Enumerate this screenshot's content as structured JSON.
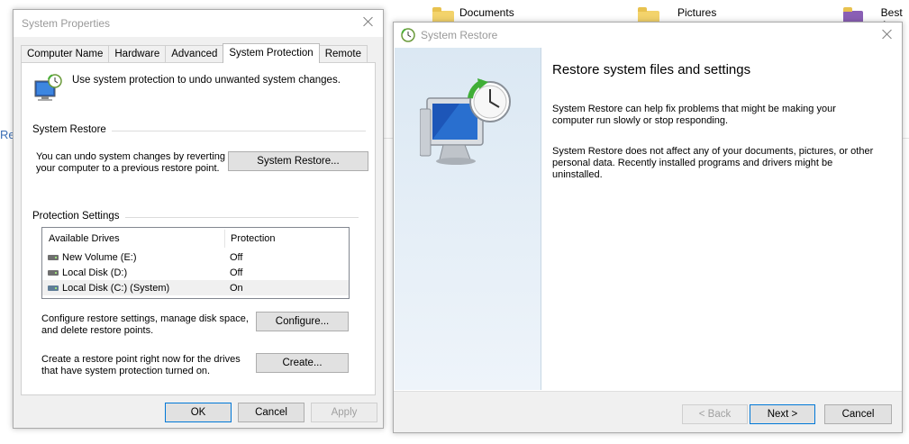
{
  "background": {
    "folders": [
      {
        "label": "Documents"
      },
      {
        "label": "Pictures"
      },
      {
        "label": "Best A"
      }
    ],
    "stub_text": "Re"
  },
  "system_properties": {
    "title": "System Properties",
    "tabs": [
      {
        "label": "Computer Name",
        "active": false
      },
      {
        "label": "Hardware",
        "active": false
      },
      {
        "label": "Advanced",
        "active": false
      },
      {
        "label": "System Protection",
        "active": true
      },
      {
        "label": "Remote",
        "active": false
      }
    ],
    "intro": "Use system protection to undo unwanted system changes.",
    "system_restore_group": {
      "title": "System Restore",
      "description": "You can undo system changes by reverting your computer to a previous restore point.",
      "button": "System Restore..."
    },
    "protection_group": {
      "title": "Protection Settings",
      "columns": [
        "Available Drives",
        "Protection"
      ],
      "drives": [
        {
          "name": "New Volume (E:)",
          "protection": "Off",
          "system": false,
          "selected": false
        },
        {
          "name": "Local Disk (D:)",
          "protection": "Off",
          "system": false,
          "selected": false
        },
        {
          "name": "Local Disk (C:) (System)",
          "protection": "On",
          "system": true,
          "selected": true
        }
      ],
      "configure_text": "Configure restore settings, manage disk space, and delete restore points.",
      "configure_button": "Configure...",
      "create_text": "Create a restore point right now for the drives that have system protection turned on.",
      "create_button": "Create..."
    },
    "buttons": {
      "ok": "OK",
      "cancel": "Cancel",
      "apply": "Apply"
    }
  },
  "system_restore": {
    "title": "System Restore",
    "heading": "Restore system files and settings",
    "paragraph1": "System Restore can help fix problems that might be making your computer run slowly or stop responding.",
    "paragraph2": "System Restore does not affect any of your documents, pictures, or other personal data. Recently installed programs and drivers might be uninstalled.",
    "buttons": {
      "back": "< Back",
      "next": "Next >",
      "cancel": "Cancel"
    }
  },
  "colors": {
    "dialog_face": "#f0f0f0",
    "accent": "#0078d7",
    "wizard_panel": "#dbe8f3"
  }
}
